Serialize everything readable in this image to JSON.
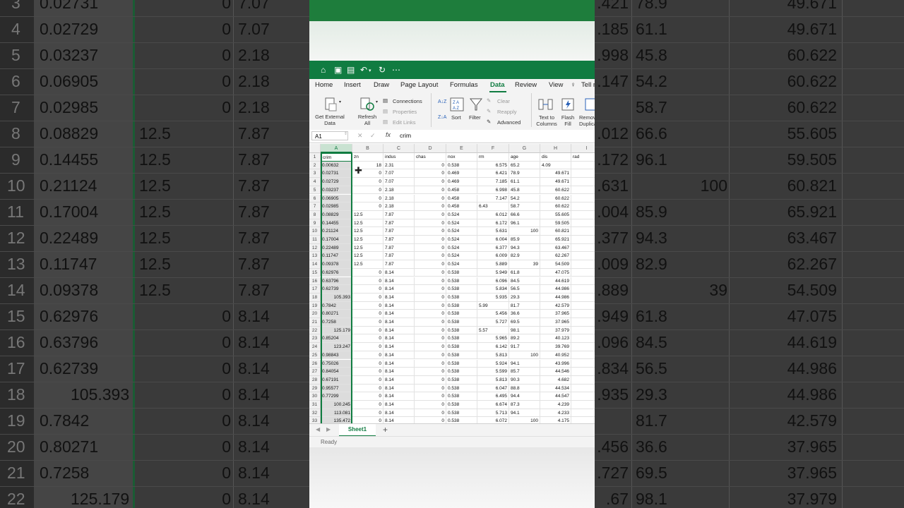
{
  "colors": {
    "accent": "#107c41",
    "selected_col": "#c9e2d1"
  },
  "qat_icons": [
    "home-icon",
    "save-icon",
    "save-as-icon",
    "undo-icon",
    "redo-icon",
    "more-icon"
  ],
  "tabs": [
    "Home",
    "Insert",
    "Draw",
    "Page Layout",
    "Formulas",
    "Data",
    "Review",
    "View",
    "Tell me"
  ],
  "active_tab": "Data",
  "ribbon": {
    "get_external_data": "Get External Data",
    "refresh_all": "Refresh All",
    "connections": "Connections",
    "properties": "Properties",
    "edit_links": "Edit Links",
    "sort": "Sort",
    "filter": "Filter",
    "clear": "Clear",
    "reapply": "Reapply",
    "advanced": "Advanced",
    "text_to_columns": "Text to Columns",
    "flash_fill": "Flash Fill",
    "remove_duplicates": "Remove Duplicates"
  },
  "formula_bar": {
    "name_box": "A1",
    "fx": "fx",
    "content": "crim"
  },
  "columns": [
    "A",
    "B",
    "C",
    "D",
    "E",
    "F",
    "G",
    "H",
    "I"
  ],
  "headers": [
    "crim",
    "zn",
    "indus",
    "chas",
    "nox",
    "rm",
    "age",
    "dis",
    "rad"
  ],
  "rows": [
    [
      "0.00632",
      "18",
      "2.31",
      "0",
      "0.538",
      "6.575",
      "65.2",
      "4.09",
      ""
    ],
    [
      "0.02731",
      "0",
      "7.07",
      "0",
      "0.469",
      "6.421",
      "78.9",
      "49.671",
      ""
    ],
    [
      "0.02729",
      "0",
      "7.07",
      "0",
      "0.469",
      "7.185",
      "61.1",
      "49.671",
      ""
    ],
    [
      "0.03237",
      "0",
      "2.18",
      "0",
      "0.458",
      "6.998",
      "45.8",
      "60.622",
      ""
    ],
    [
      "0.06905",
      "0",
      "2.18",
      "0",
      "0.458",
      "7.147",
      "54.2",
      "60.622",
      ""
    ],
    [
      "0.02985",
      "0",
      "2.18",
      "0",
      "0.458",
      "6.43",
      "58.7",
      "60.622",
      ""
    ],
    [
      "0.08829",
      "12.5",
      "7.87",
      "0",
      "0.524",
      "6.012",
      "66.6",
      "55.605",
      ""
    ],
    [
      "0.14455",
      "12.5",
      "7.87",
      "0",
      "0.524",
      "6.172",
      "96.1",
      "59.505",
      ""
    ],
    [
      "0.21124",
      "12.5",
      "7.87",
      "0",
      "0.524",
      "5.631",
      "100",
      "60.821",
      ""
    ],
    [
      "0.17004",
      "12.5",
      "7.87",
      "0",
      "0.524",
      "6.004",
      "85.9",
      "65.921",
      ""
    ],
    [
      "0.22489",
      "12.5",
      "7.87",
      "0",
      "0.524",
      "6.377",
      "94.3",
      "63.467",
      ""
    ],
    [
      "0.11747",
      "12.5",
      "7.87",
      "0",
      "0.524",
      "6.009",
      "82.9",
      "62.267",
      ""
    ],
    [
      "0.09378",
      "12.5",
      "7.87",
      "0",
      "0.524",
      "5.889",
      "39",
      "54.509",
      ""
    ],
    [
      "0.62976",
      "0",
      "8.14",
      "0",
      "0.538",
      "5.949",
      "61.8",
      "47.075",
      ""
    ],
    [
      "0.63796",
      "0",
      "8.14",
      "0",
      "0.538",
      "6.096",
      "84.5",
      "44.619",
      ""
    ],
    [
      "0.62739",
      "0",
      "8.14",
      "0",
      "0.538",
      "5.834",
      "56.5",
      "44.986",
      ""
    ],
    [
      "105.393",
      "0",
      "8.14",
      "0",
      "0.538",
      "5.935",
      "29.3",
      "44.986",
      ""
    ],
    [
      "0.7842",
      "0",
      "8.14",
      "0",
      "0.538",
      "5.99",
      "81.7",
      "42.579",
      ""
    ],
    [
      "0.80271",
      "0",
      "8.14",
      "0",
      "0.538",
      "5.456",
      "36.6",
      "37.965",
      ""
    ],
    [
      "0.7258",
      "0",
      "8.14",
      "0",
      "0.538",
      "5.727",
      "69.5",
      "37.965",
      ""
    ],
    [
      "125.179",
      "0",
      "8.14",
      "0",
      "0.538",
      "5.57",
      "98.1",
      "37.979",
      ""
    ],
    [
      "0.85204",
      "0",
      "8.14",
      "0",
      "0.538",
      "5.965",
      "89.2",
      "40.123",
      ""
    ],
    [
      "123.247",
      "0",
      "8.14",
      "0",
      "0.538",
      "6.142",
      "91.7",
      "39.769",
      ""
    ],
    [
      "0.98843",
      "0",
      "8.14",
      "0",
      "0.538",
      "5.813",
      "100",
      "40.952",
      ""
    ],
    [
      "0.75026",
      "0",
      "8.14",
      "0",
      "0.538",
      "5.924",
      "94.1",
      "43.996",
      ""
    ],
    [
      "0.84054",
      "0",
      "8.14",
      "0",
      "0.538",
      "5.599",
      "85.7",
      "44.546",
      ""
    ],
    [
      "0.67191",
      "0",
      "8.14",
      "0",
      "0.538",
      "5.813",
      "90.3",
      "4.682",
      ""
    ],
    [
      "0.95577",
      "0",
      "8.14",
      "0",
      "0.538",
      "6.047",
      "88.8",
      "44.534",
      ""
    ],
    [
      "0.77299",
      "0",
      "8.14",
      "0",
      "0.538",
      "6.495",
      "94.4",
      "44.547",
      ""
    ],
    [
      "100.245",
      "0",
      "8.14",
      "0",
      "0.538",
      "6.674",
      "87.3",
      "4.239",
      ""
    ],
    [
      "113.081",
      "0",
      "8.14",
      "0",
      "0.538",
      "5.713",
      "94.1",
      "4.233",
      ""
    ],
    [
      "135.472",
      "0",
      "8.14",
      "0",
      "0.538",
      "6.072",
      "100",
      "4.175",
      ""
    ]
  ],
  "sheet_tab": "Sheet1",
  "status": "Ready",
  "bg_left_rows": [
    {
      "n": "3",
      "a": "0.02731",
      "b": "0",
      "c": "7.07"
    },
    {
      "n": "4",
      "a": "0.02729",
      "b": "0",
      "c": "7.07"
    },
    {
      "n": "5",
      "a": "0.03237",
      "b": "0",
      "c": "2.18"
    },
    {
      "n": "6",
      "a": "0.06905",
      "b": "0",
      "c": "2.18"
    },
    {
      "n": "7",
      "a": "0.02985",
      "b": "0",
      "c": "2.18"
    },
    {
      "n": "8",
      "a": "0.08829",
      "b": "12.5",
      "c": "7.87"
    },
    {
      "n": "9",
      "a": "0.14455",
      "b": "12.5",
      "c": "7.87"
    },
    {
      "n": "10",
      "a": "0.21124",
      "b": "12.5",
      "c": "7.87"
    },
    {
      "n": "11",
      "a": "0.17004",
      "b": "12.5",
      "c": "7.87"
    },
    {
      "n": "12",
      "a": "0.22489",
      "b": "12.5",
      "c": "7.87"
    },
    {
      "n": "13",
      "a": "0.11747",
      "b": "12.5",
      "c": "7.87"
    },
    {
      "n": "14",
      "a": "0.09378",
      "b": "12.5",
      "c": "7.87"
    },
    {
      "n": "15",
      "a": "0.62976",
      "b": "0",
      "c": "8.14"
    },
    {
      "n": "16",
      "a": "0.63796",
      "b": "0",
      "c": "8.14"
    },
    {
      "n": "17",
      "a": "0.62739",
      "b": "0",
      "c": "8.14"
    },
    {
      "n": "18",
      "a": "105.393",
      "b": "0",
      "c": "8.14"
    },
    {
      "n": "19",
      "a": "0.7842",
      "b": "0",
      "c": "8.14"
    },
    {
      "n": "20",
      "a": "0.80271",
      "b": "0",
      "c": "8.14"
    },
    {
      "n": "21",
      "a": "0.7258",
      "b": "0",
      "c": "8.14"
    },
    {
      "n": "22",
      "a": "125.179",
      "b": "0",
      "c": "8.14"
    }
  ],
  "bg_right_rows": [
    {
      "g": "78.9",
      "i": "",
      "h": "49.671"
    },
    {
      "g": "61.1",
      "i": "",
      "h": "49.671"
    },
    {
      "g": "45.8",
      "i": "",
      "h": "60.622"
    },
    {
      "g": "54.2",
      "i": "",
      "h": "60.622"
    },
    {
      "g": "58.7",
      "i": "",
      "h": "60.622"
    },
    {
      "g": "66.6",
      "i": "",
      "h": "55.605"
    },
    {
      "g": "96.1",
      "i": "",
      "h": "59.505"
    },
    {
      "g": "",
      "i": "100",
      "h": "60.821"
    },
    {
      "g": "85.9",
      "i": "",
      "h": "65.921"
    },
    {
      "g": "94.3",
      "i": "",
      "h": "63.467"
    },
    {
      "g": "82.9",
      "i": "",
      "h": "62.267"
    },
    {
      "g": "",
      "i": "39",
      "h": "54.509"
    },
    {
      "g": "61.8",
      "i": "",
      "h": "47.075"
    },
    {
      "g": "84.5",
      "i": "",
      "h": "44.619"
    },
    {
      "g": "56.5",
      "i": "",
      "h": "44.986"
    },
    {
      "g": "29.3",
      "i": "",
      "h": "44.986"
    },
    {
      "g": "81.7",
      "i": "",
      "h": "42.579"
    },
    {
      "g": "36.6",
      "i": "",
      "h": "37.965"
    },
    {
      "g": "69.5",
      "i": "",
      "h": "37.965"
    },
    {
      "g": "98.1",
      "i": "",
      "h": "37.979"
    }
  ],
  "bg_right_f": [
    ".421",
    ".185",
    ".998",
    ".147",
    "",
    ".012",
    ".172",
    ".631",
    ".004",
    ".377",
    ".009",
    ".889",
    ".949",
    ".096",
    ".834",
    ".935",
    "",
    ".456",
    ".727",
    ".67"
  ]
}
